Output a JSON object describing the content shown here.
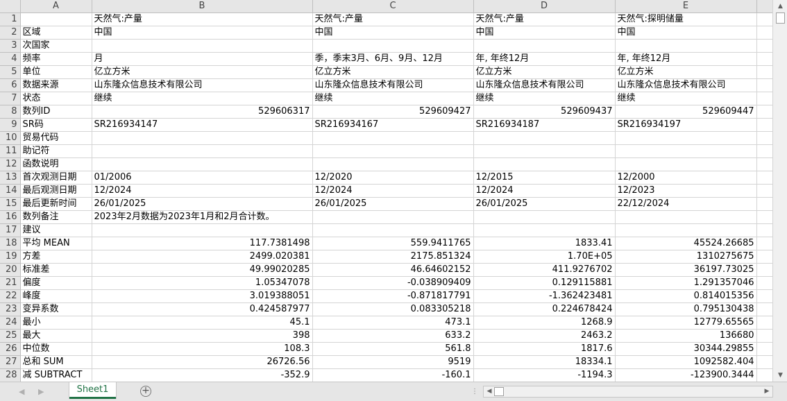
{
  "columns": [
    "A",
    "B",
    "C",
    "D",
    "E"
  ],
  "rows": [
    {
      "n": "1",
      "cells": [
        "",
        "天然气:产量",
        "天然气:产量",
        "天然气:产量",
        "天然气:探明储量"
      ]
    },
    {
      "n": "2",
      "cells": [
        "区域",
        "中国",
        "中国",
        "中国",
        "中国"
      ]
    },
    {
      "n": "3",
      "cells": [
        "次国家",
        "",
        "",
        "",
        ""
      ]
    },
    {
      "n": "4",
      "cells": [
        "频率",
        "月",
        "季，季末3月、6月、9月、12月",
        "年, 年终12月",
        "年, 年终12月"
      ]
    },
    {
      "n": "5",
      "cells": [
        "单位",
        "亿立方米",
        "亿立方米",
        "亿立方米",
        "亿立方米"
      ]
    },
    {
      "n": "6",
      "cells": [
        "数据来源",
        "山东隆众信息技术有限公司",
        "山东隆众信息技术有限公司",
        "山东隆众信息技术有限公司",
        "山东隆众信息技术有限公司"
      ]
    },
    {
      "n": "7",
      "cells": [
        "状态",
        "继续",
        "继续",
        "继续",
        "继续"
      ]
    },
    {
      "n": "8",
      "cells": [
        "数列ID",
        "529606317",
        "529609427",
        "529609437",
        "529609447"
      ]
    },
    {
      "n": "9",
      "cells": [
        "SR码",
        "SR216934147",
        "SR216934167",
        "SR216934187",
        "SR216934197"
      ]
    },
    {
      "n": "10",
      "cells": [
        "贸易代码",
        "",
        "",
        "",
        ""
      ]
    },
    {
      "n": "11",
      "cells": [
        "助记符",
        "",
        "",
        "",
        ""
      ]
    },
    {
      "n": "12",
      "cells": [
        "函数说明",
        "",
        "",
        "",
        ""
      ]
    },
    {
      "n": "13",
      "cells": [
        "首次观测日期",
        "01/2006",
        "12/2020",
        "12/2015",
        "12/2000"
      ]
    },
    {
      "n": "14",
      "cells": [
        "最后观测日期",
        "12/2024",
        "12/2024",
        "12/2024",
        "12/2023"
      ]
    },
    {
      "n": "15",
      "cells": [
        "最后更新时间",
        "26/01/2025",
        "26/01/2025",
        "26/01/2025",
        "22/12/2024"
      ]
    },
    {
      "n": "16",
      "cells": [
        "数列备注",
        "2023年2月数据为2023年1月和2月合计数。",
        "",
        "",
        ""
      ]
    },
    {
      "n": "17",
      "cells": [
        "建议",
        "",
        "",
        "",
        ""
      ]
    },
    {
      "n": "18",
      "cells": [
        "平均 MEAN",
        "117.7381498",
        "559.9411765",
        "1833.41",
        "45524.26685"
      ]
    },
    {
      "n": "19",
      "cells": [
        "方差",
        "2499.020381",
        "2175.851324",
        "1.70E+05",
        "1310275675"
      ]
    },
    {
      "n": "20",
      "cells": [
        "标准差",
        "49.99020285",
        "46.64602152",
        "411.9276702",
        "36197.73025"
      ]
    },
    {
      "n": "21",
      "cells": [
        "偏度",
        "1.05347078",
        "-0.038909409",
        "0.129115881",
        "1.291357046"
      ]
    },
    {
      "n": "22",
      "cells": [
        "峰度",
        "3.019388051",
        "-0.871817791",
        "-1.362423481",
        "0.814015356"
      ]
    },
    {
      "n": "23",
      "cells": [
        "变异系数",
        "0.424587977",
        "0.083305218",
        "0.224678424",
        "0.795130438"
      ]
    },
    {
      "n": "24",
      "cells": [
        "最小",
        "45.1",
        "473.1",
        "1268.9",
        "12779.65565"
      ]
    },
    {
      "n": "25",
      "cells": [
        "最大",
        "398",
        "633.2",
        "2463.2",
        "136680"
      ]
    },
    {
      "n": "26",
      "cells": [
        "中位数",
        "108.3",
        "561.8",
        "1817.6",
        "30344.29855"
      ]
    },
    {
      "n": "27",
      "cells": [
        "总和 SUM",
        "26726.56",
        "9519",
        "18334.1",
        "1092582.404"
      ]
    },
    {
      "n": "28",
      "cells": [
        "减 SUBTRACT",
        "-352.9",
        "-160.1",
        "-1194.3",
        "-123900.3444"
      ]
    }
  ],
  "numeric_rows": [
    "8",
    "18",
    "19",
    "20",
    "21",
    "22",
    "23",
    "24",
    "25",
    "26",
    "27",
    "28"
  ],
  "sheet_tabs": [
    {
      "label": "Sheet1",
      "active": true
    }
  ],
  "icons": {
    "add_sheet": "plus-circle-icon",
    "tab_nav_prev": "triangle-left-icon",
    "tab_nav_next": "triangle-right-icon",
    "scroll_up": "triangle-up-icon",
    "scroll_down": "triangle-down-icon",
    "scroll_left": "triangle-left-icon",
    "scroll_right": "triangle-right-icon"
  },
  "colors": {
    "accent": "#217346",
    "header_bg": "#e6e6e6",
    "gridline": "#d4d4d4"
  }
}
